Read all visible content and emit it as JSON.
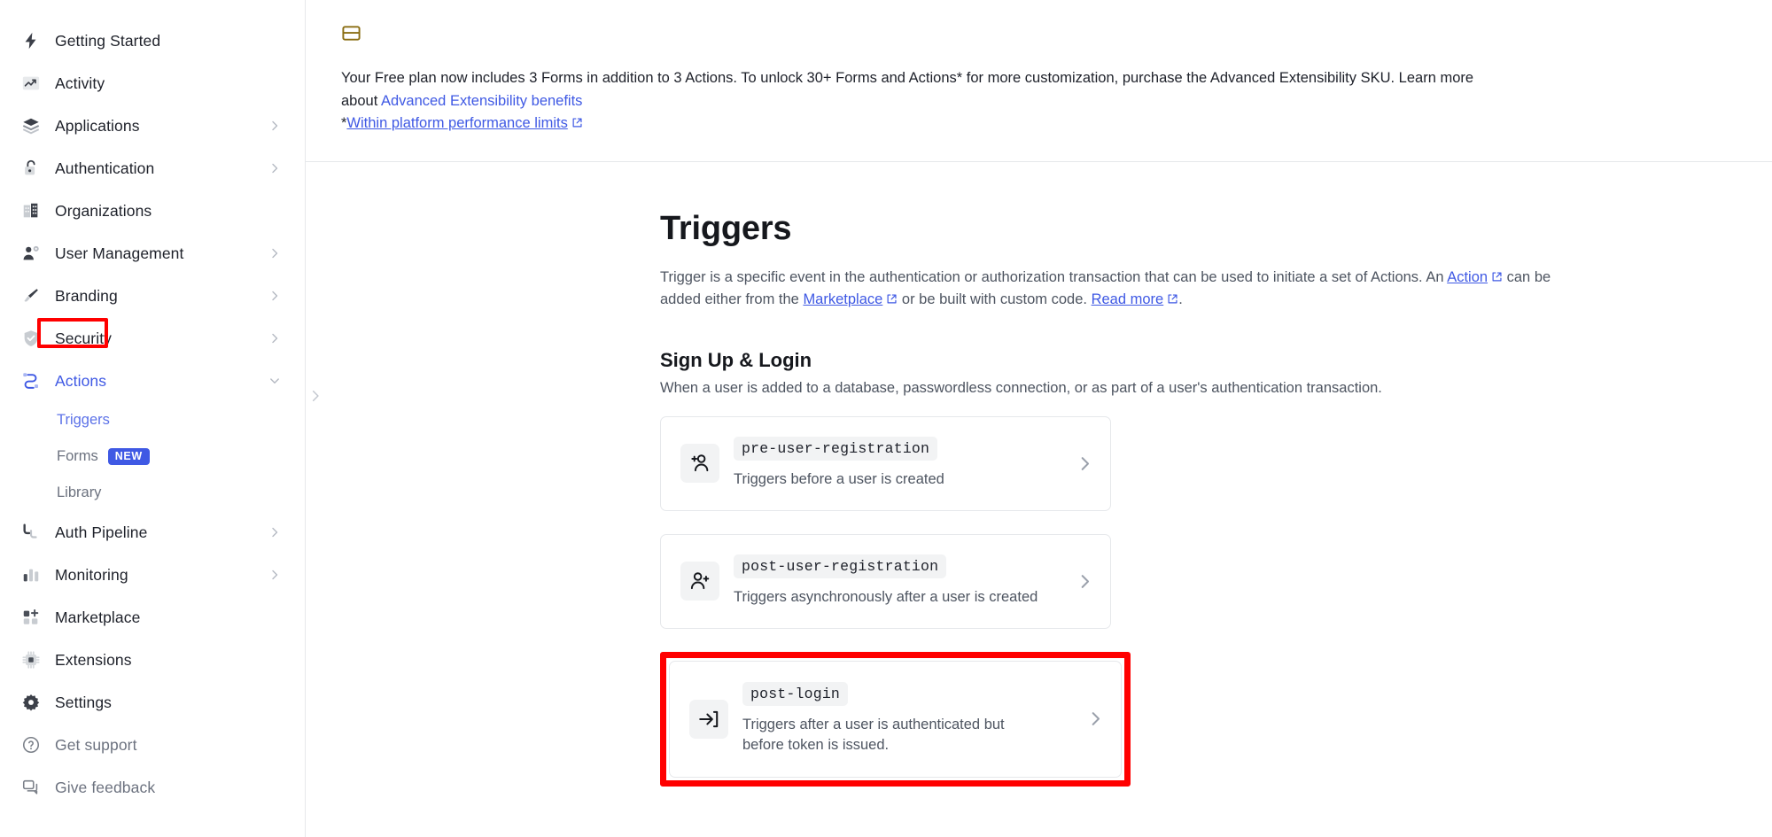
{
  "sidebar": {
    "items": [
      {
        "label": "Getting Started",
        "icon": "bolt-icon",
        "expandable": false
      },
      {
        "label": "Activity",
        "icon": "activity-chart-icon",
        "expandable": false
      },
      {
        "label": "Applications",
        "icon": "layers-icon",
        "expandable": true
      },
      {
        "label": "Authentication",
        "icon": "lock-icon",
        "expandable": true
      },
      {
        "label": "Organizations",
        "icon": "building-icon",
        "expandable": false
      },
      {
        "label": "User Management",
        "icon": "user-gear-icon",
        "expandable": true
      },
      {
        "label": "Branding",
        "icon": "brush-icon",
        "expandable": true
      },
      {
        "label": "Security",
        "icon": "shield-check-icon",
        "expandable": true
      },
      {
        "label": "Actions",
        "icon": "actions-flow-icon",
        "expandable": true,
        "active": true
      }
    ],
    "actions_children": [
      {
        "label": "Triggers",
        "active": true,
        "highlighted": true
      },
      {
        "label": "Forms",
        "badge": "NEW"
      },
      {
        "label": "Library"
      }
    ],
    "items_after": [
      {
        "label": "Auth Pipeline",
        "icon": "pipeline-icon",
        "expandable": true
      },
      {
        "label": "Monitoring",
        "icon": "bar-chart-icon",
        "expandable": true
      },
      {
        "label": "Marketplace",
        "icon": "marketplace-plus-icon",
        "expandable": false
      },
      {
        "label": "Extensions",
        "icon": "extensions-chip-icon",
        "expandable": false
      },
      {
        "label": "Settings",
        "icon": "gear-icon",
        "expandable": false
      }
    ],
    "footer_items": [
      {
        "label": "Get support",
        "icon": "question-circle-icon"
      },
      {
        "label": "Give feedback",
        "icon": "feedback-bubbles-icon"
      }
    ]
  },
  "banner": {
    "icon": "announcement-card-icon",
    "line1_a": "Your Free plan now includes 3 Forms in addition to 3 Actions. To unlock 30+ Forms and Actions* for more customization, purchase the Advanced Extensibility SKU. Learn more",
    "line2_prefix": "about ",
    "line2_link": "Advanced Extensibility benefits",
    "line3_asterisk": "*",
    "line3_link": "Within platform performance limits"
  },
  "page": {
    "title": "Triggers",
    "desc_part1": "Trigger is a specific event in the authentication or authorization transaction that can be used to initiate a set of Actions. An ",
    "desc_link1": "Action",
    "desc_part2": " can be added either from the ",
    "desc_link2": "Marketplace",
    "desc_part3": " or be built with custom code. ",
    "desc_link3": "Read more",
    "desc_part4": "."
  },
  "section": {
    "title": "Sign Up & Login",
    "desc": "When a user is added to a database, passwordless connection, or as part of a user's authentication transaction."
  },
  "cards": [
    {
      "name": "pre-user-registration",
      "desc": "Triggers before a user is created",
      "icon": "user-plus-left-icon"
    },
    {
      "name": "post-user-registration",
      "desc": "Triggers asynchronously after a user is created",
      "icon": "user-plus-right-icon"
    },
    {
      "name": "post-login",
      "desc": "Triggers after a user is authenticated but before token is issued.",
      "icon": "login-arrow-icon",
      "highlighted": true
    }
  ],
  "colors": {
    "accent": "#3f59e4",
    "highlight": "#ff0000",
    "text": "#1e212a",
    "muted": "#6c727f",
    "border": "#e6e8eb"
  }
}
